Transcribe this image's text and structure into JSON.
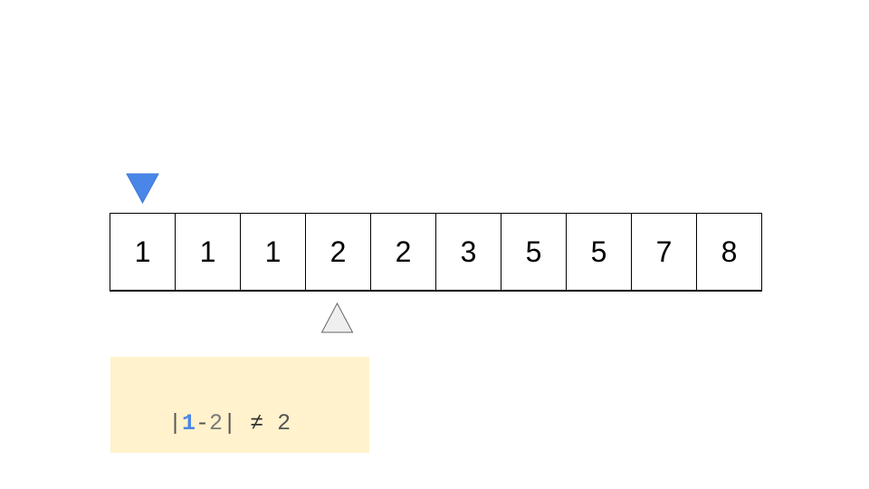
{
  "array": {
    "values": [
      "1",
      "1",
      "1",
      "2",
      "2",
      "3",
      "5",
      "5",
      "7",
      "8"
    ]
  },
  "pointers": {
    "left_index": 0,
    "right_index": 3,
    "left_color": "#4a86e8",
    "right_color": "#efefef"
  },
  "formula": {
    "open_bar": "|",
    "left_value": "1",
    "minus": "-",
    "right_value": "2",
    "close_bar": "|",
    "relation": "≠",
    "target": "2",
    "background": "#fff2cc"
  }
}
